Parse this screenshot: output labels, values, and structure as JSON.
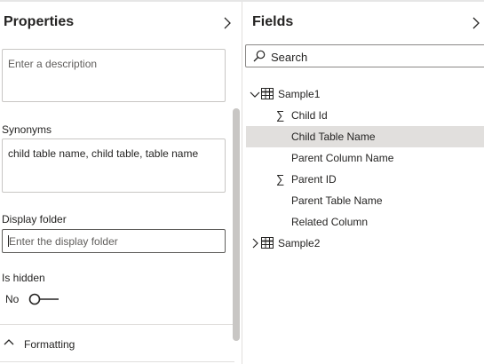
{
  "properties": {
    "title": "Properties",
    "description_placeholder": "Enter a description",
    "synonyms_label": "Synonyms",
    "synonyms_value": "child table name, child table, table name",
    "display_folder_label": "Display folder",
    "display_folder_placeholder": "Enter the display folder",
    "is_hidden_label": "Is hidden",
    "is_hidden_value": "No",
    "is_hidden_on": false,
    "formatting_label": "Formatting"
  },
  "fields": {
    "title": "Fields",
    "search_placeholder": "Search",
    "tables": [
      {
        "name": "Sample1",
        "expanded": true,
        "columns": [
          {
            "name": "Child Id",
            "icon": "sigma-icon"
          },
          {
            "name": "Child Table Name",
            "icon": "",
            "selected": true
          },
          {
            "name": "Parent Column Name",
            "icon": ""
          },
          {
            "name": "Parent ID",
            "icon": "sigma-icon"
          },
          {
            "name": "Parent Table Name",
            "icon": ""
          },
          {
            "name": "Related Column",
            "icon": ""
          }
        ]
      },
      {
        "name": "Sample2",
        "expanded": false,
        "columns": []
      }
    ]
  },
  "colors": {
    "selected_row": "#e1dfdd",
    "border": "#c8c6c4",
    "text": "#252423"
  }
}
